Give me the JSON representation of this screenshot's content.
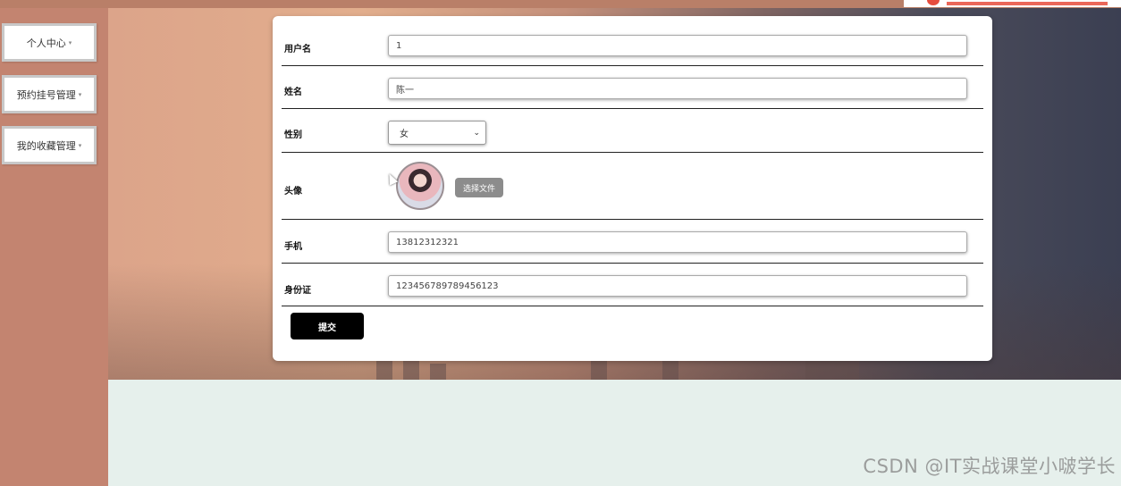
{
  "sidebar": {
    "items": [
      {
        "label": "个人中心"
      },
      {
        "label": "预约挂号管理"
      },
      {
        "label": "我的收藏管理"
      }
    ],
    "caret": "▾"
  },
  "form": {
    "fields": {
      "username": {
        "label": "用户名",
        "value": "1"
      },
      "name": {
        "label": "姓名",
        "value": "陈一"
      },
      "gender": {
        "label": "性别",
        "selected": "女"
      },
      "avatar": {
        "label": "头像",
        "choose_file": "选择文件"
      },
      "phone": {
        "label": "手机",
        "value": "13812312321"
      },
      "id_card": {
        "label": "身份证",
        "value": "123456789789456123"
      }
    },
    "submit_label": "提交"
  },
  "watermark": "CSDN @IT实战课堂小啵学长",
  "colors": {
    "sidebar_bg": "#c38470",
    "button_bg": "#000000",
    "file_button_bg": "#8c8c8c",
    "bottom_bg": "#e6f0ec"
  },
  "icons": {
    "select_chevron": "chevron-down-icon",
    "cursor": "mouse-pointer-icon"
  }
}
